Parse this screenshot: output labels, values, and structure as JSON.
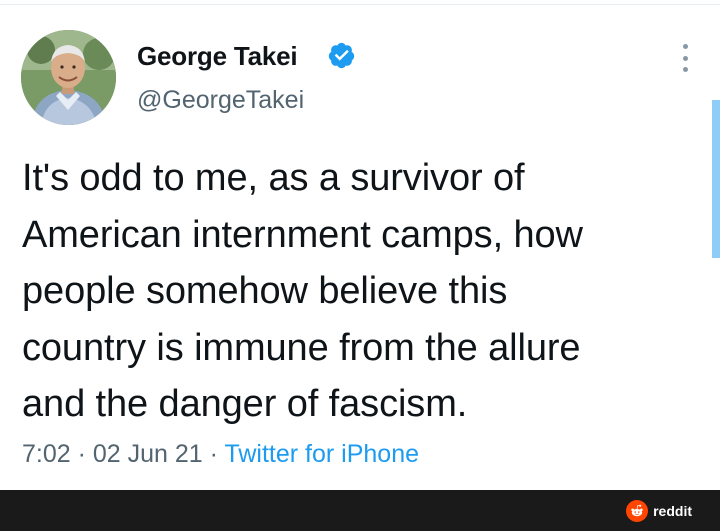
{
  "tweet": {
    "display_name": "George Takei",
    "handle": "@GeorgeTakei",
    "verified": true,
    "verified_icon": "verified-badge-icon",
    "text_lines": [
      "It's odd to me, as a survivor of",
      "American internment camps, how",
      "people somehow believe this",
      "country is immune from the allure",
      "and the danger of fascism."
    ],
    "time": "7:02",
    "date": "02 Jun 21",
    "separator": " · ",
    "source": "Twitter for iPhone",
    "more_icon": "more-options-icon"
  },
  "footer": {
    "watermark": "reddit",
    "watermark_icon": "reddit-logo-icon",
    "background": "#1a1a1b"
  },
  "colors": {
    "text": "#0f1419",
    "secondary_text": "#536471",
    "link": "#1d9bf0",
    "verified": "#1d9bf0",
    "reddit": "#ff4500"
  }
}
